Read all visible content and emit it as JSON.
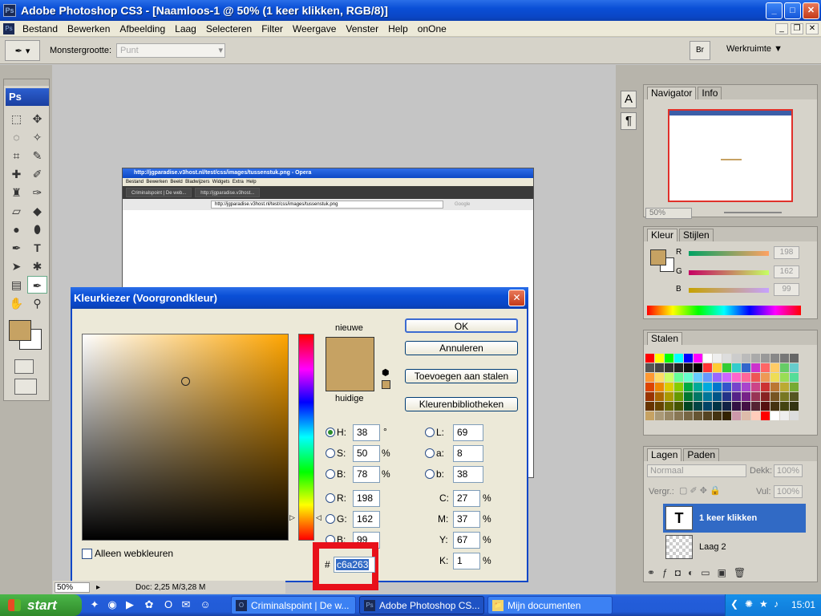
{
  "window": {
    "title": "Adobe Photoshop CS3 - [Naamloos-1 @ 50% (1 keer klikken, RGB/8)]",
    "icon": "Ps",
    "controls": {
      "minimize": "_",
      "maximize": "□",
      "close": "✕"
    }
  },
  "menu": {
    "logo": "Ps",
    "items": [
      "Bestand",
      "Bewerken",
      "Afbeelding",
      "Laag",
      "Selecteren",
      "Filter",
      "Weergave",
      "Venster",
      "Help",
      "onOne"
    ]
  },
  "options": {
    "sample_label": "Monstergrootte:",
    "sample_value": "Punt",
    "bridge_label": "Br",
    "workspace_label": "Werkruimte ▼"
  },
  "toolbox": {
    "logo": "Ps",
    "foreground_color": "#c6a263",
    "background_color": "#ffffff"
  },
  "navigator": {
    "tabs": [
      "Navigator",
      "Info"
    ],
    "zoom": "50%"
  },
  "color_panel": {
    "tabs": [
      "Kleur",
      "Stijlen"
    ],
    "channels": [
      {
        "label": "R",
        "value": "198"
      },
      {
        "label": "G",
        "value": "162"
      },
      {
        "label": "B",
        "value": "99"
      }
    ]
  },
  "swatches_panel": {
    "tabs": [
      "Stalen"
    ]
  },
  "layers_panel": {
    "tabs": [
      "Lagen",
      "Paden"
    ],
    "blend_mode": "Normaal",
    "opacity_label": "Dekk:",
    "opacity_value": "100%",
    "lock_label": "Vergr.:",
    "fill_label": "Vul:",
    "fill_value": "100%",
    "layers": [
      {
        "name": "1 keer klikken",
        "thumb": "T"
      },
      {
        "name": "Laag 2",
        "thumb": ""
      }
    ]
  },
  "opera": {
    "title": "http://jgparadise.v3host.nl/test/css/images/tussenstuk.png - Opera",
    "menu": [
      "Bestand",
      "Bewerken",
      "Beeld",
      "Bladwijzers",
      "Widgets",
      "Extra",
      "Help"
    ],
    "tabs": [
      "Criminalspoint | De web...",
      "http://jgparadise.v3host..."
    ],
    "address": "http://jgparadise.v3host.nl/test/css/images/tussenstuk.png",
    "search_placeholder": "Google"
  },
  "dialog": {
    "title": "Kleurkiezer (Voorgrondkleur)",
    "new_label": "nieuwe",
    "current_label": "huidige",
    "color": "#c6a263",
    "buttons": {
      "ok": "OK",
      "cancel": "Annuleren",
      "add_to_swatches": "Toevoegen aan stalen",
      "color_libraries": "Kleurenbibliotheken"
    },
    "hsb": [
      {
        "label": "H:",
        "value": "38",
        "unit": "°"
      },
      {
        "label": "S:",
        "value": "50",
        "unit": "%"
      },
      {
        "label": "B:",
        "value": "78",
        "unit": "%"
      }
    ],
    "rgb": [
      {
        "label": "R:",
        "value": "198"
      },
      {
        "label": "G:",
        "value": "162"
      },
      {
        "label": "B:",
        "value": "99"
      }
    ],
    "lab": [
      {
        "label": "L:",
        "value": "69"
      },
      {
        "label": "a:",
        "value": "8"
      },
      {
        "label": "b:",
        "value": "38"
      }
    ],
    "cmyk": [
      {
        "label": "C:",
        "value": "27",
        "unit": "%"
      },
      {
        "label": "M:",
        "value": "37",
        "unit": "%"
      },
      {
        "label": "Y:",
        "value": "67",
        "unit": "%"
      },
      {
        "label": "K:",
        "value": "1",
        "unit": "%"
      }
    ],
    "hex_label": "#",
    "hex_value": "c6a263",
    "web_colors_label": "Alleen webkleuren"
  },
  "status": {
    "zoom": "50%",
    "doc": "Doc: 2,25 M/3,28 M"
  },
  "taskbar": {
    "start": "start",
    "tasks": [
      {
        "label": "Criminalspoint | De w...",
        "icon": "O"
      },
      {
        "label": "Adobe Photoshop CS...",
        "icon": "Ps"
      },
      {
        "label": "Mijn documenten",
        "icon": "📁"
      }
    ],
    "clock": "15:01"
  }
}
